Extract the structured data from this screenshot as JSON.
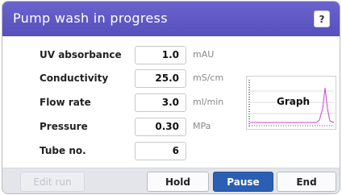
{
  "window": {
    "title": "Pump wash in progress",
    "help_label": "?"
  },
  "params": [
    {
      "label": "UV absorbance",
      "value": "1.0",
      "unit": "mAU"
    },
    {
      "label": "Conductivity",
      "value": "25.0",
      "unit": "mS/cm"
    },
    {
      "label": "Flow rate",
      "value": "3.0",
      "unit": "ml/min"
    },
    {
      "label": "Pressure",
      "value": "0.30",
      "unit": "MPa"
    },
    {
      "label": "Tube no.",
      "value": "6",
      "unit": ""
    }
  ],
  "graph": {
    "label": "Graph",
    "line_color": "#d040d0"
  },
  "buttons": {
    "edit_run": "Edit run",
    "hold": "Hold",
    "pause": "Pause",
    "end": "End"
  },
  "colors": {
    "title_bar": "#5f58c6",
    "primary_button": "#2b5fb4"
  }
}
